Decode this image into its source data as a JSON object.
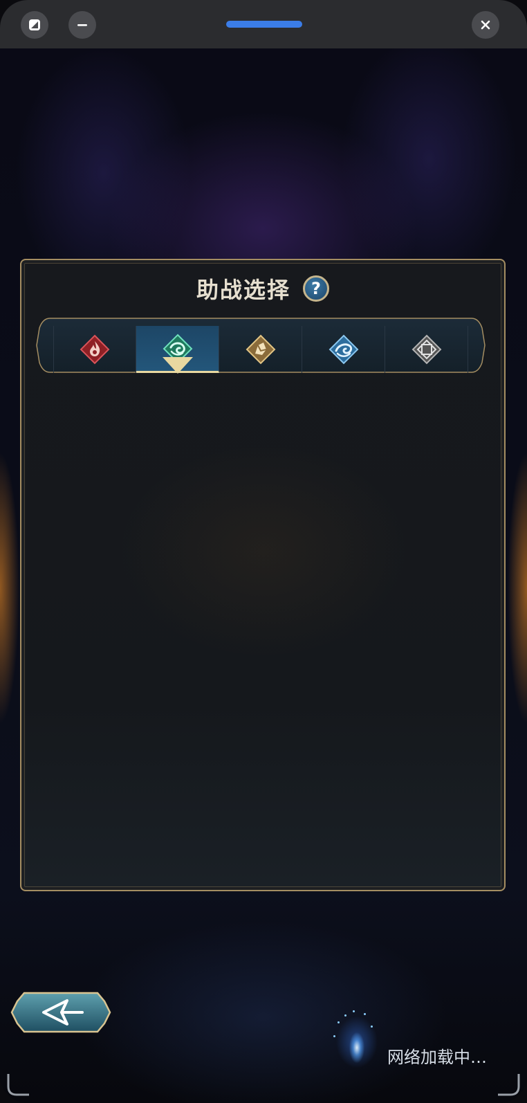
{
  "window": {
    "controls": {
      "restore_icon": "restore-icon",
      "minimize_icon": "minimize-icon",
      "close_icon": "close-icon"
    },
    "accent_color": "#3b7de8"
  },
  "panel": {
    "title": "助战选择",
    "help_label": "?",
    "tabs": [
      {
        "element": "pyro",
        "icon": "fire-element-icon",
        "color": "#c0383c",
        "selected": false
      },
      {
        "element": "anemo",
        "icon": "wind-element-icon",
        "color": "#4fc7a0",
        "selected": true
      },
      {
        "element": "geo",
        "icon": "rock-element-icon",
        "color": "#d6b46e",
        "selected": false
      },
      {
        "element": "hydro",
        "icon": "water-element-icon",
        "color": "#5aa9e0",
        "selected": false
      },
      {
        "element": "imaginary",
        "icon": "diamond-element-icon",
        "color": "#9a9a9a",
        "selected": false
      }
    ],
    "border_color": "#a58e62"
  },
  "footer": {
    "back_icon": "back-arrow-icon",
    "loading_text": "网络加载中…"
  }
}
